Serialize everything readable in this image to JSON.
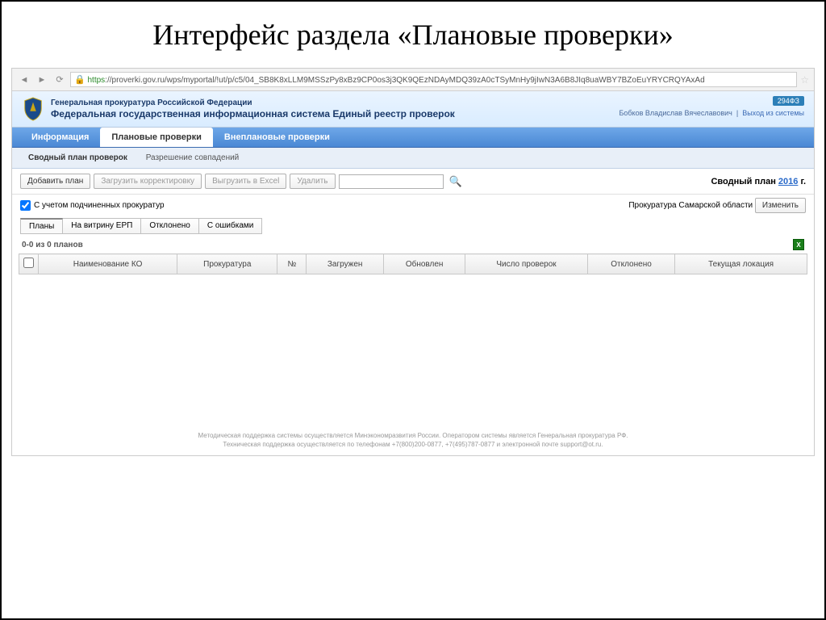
{
  "slide": {
    "title": "Интерфейс раздела «Плановые проверки»"
  },
  "browser": {
    "url_secure_part": "https",
    "url_rest": "://proverki.gov.ru/wps/myportal/!ut/p/c5/04_SB8K8xLLM9MSSzPy8xBz9CP0os3j3QK9QEzNDAyMDQ39zA0cTSyMnHy9jIwN3A6B8JIq8uaWBY7BZoEuYRYCRQYAxAd"
  },
  "header": {
    "org_line1": "Генеральная прокуратура Российской Федерации",
    "org_line2": "Федеральная государственная информационная система Единый реестр проверок",
    "law_badge": "294ФЗ",
    "user_name": "Бобков Владислав Вячеславович",
    "logout": "Выход из системы"
  },
  "tabs": {
    "info": "Информация",
    "planned": "Плановые проверки",
    "unplanned": "Внеплановые проверки"
  },
  "subtabs": {
    "summary": "Сводный план проверок",
    "resolve": "Разрешение совпадений"
  },
  "toolbar": {
    "add_plan": "Добавить план",
    "load_corr": "Загрузить корректировку",
    "export_excel": "Выгрузить в Excel",
    "delete": "Удалить",
    "search_value": "",
    "right_prefix": "Сводный план ",
    "year": "2016",
    "right_suffix": " г."
  },
  "checkbox_row": {
    "label": "С учетом подчиненных прокуратур",
    "region": "Прокуратура Самарской области",
    "change_btn": "Изменить"
  },
  "filter_tabs": {
    "plans": "Планы",
    "showcase": "На витрину ЕРП",
    "rejected": "Отклонено",
    "errors": "С ошибками"
  },
  "count_label": "0-0 из 0 планов",
  "table_headers": {
    "name": "Наименование КО",
    "prosecutor": "Прокуратура",
    "num": "№",
    "loaded": "Загружен",
    "updated": "Обновлен",
    "count": "Число проверок",
    "rejected": "Отклонено",
    "location": "Текущая локация"
  },
  "footer": {
    "line1": "Методическая поддержка системы осуществляется Минэкономразвития России. Оператором системы является Генеральная прокуратура РФ.",
    "line2": "Техническая поддержка осуществляется по телефонам +7(800)200-0877, +7(495)787-0877 и электронной почте support@ot.ru."
  }
}
